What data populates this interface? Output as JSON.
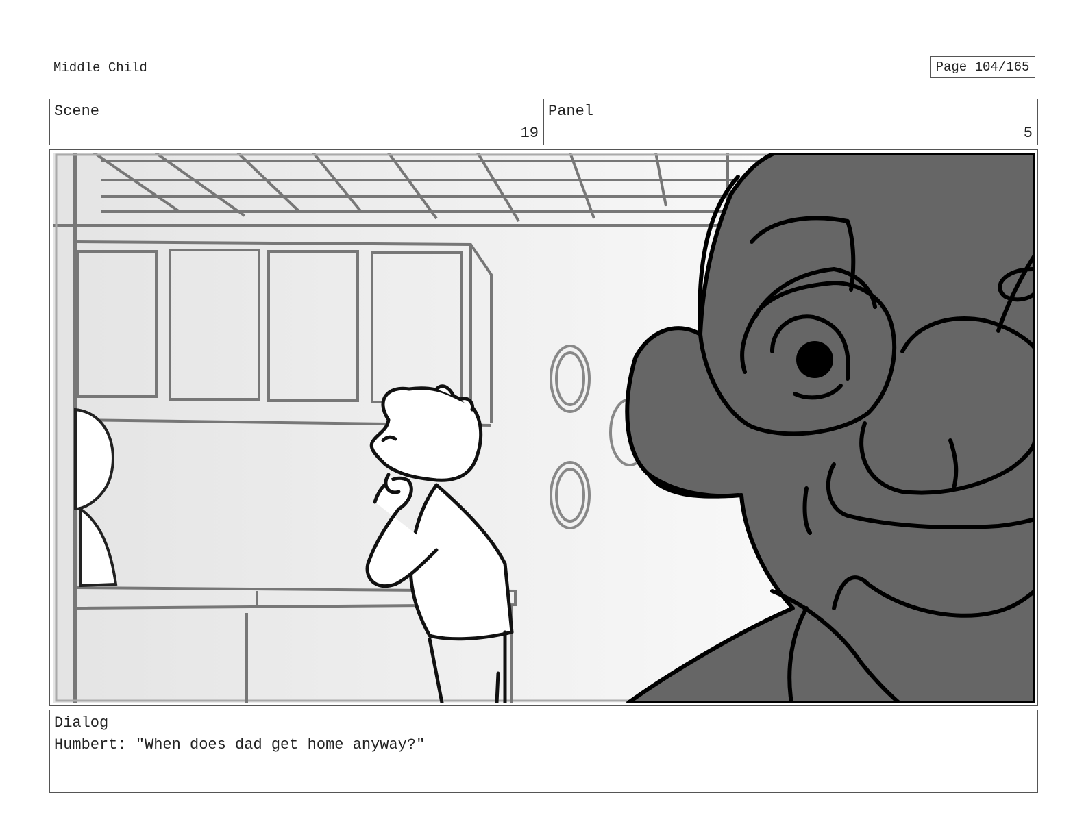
{
  "header": {
    "title": "Middle Child",
    "page": "Page 104/165"
  },
  "scene": {
    "label": "Scene",
    "value": "19"
  },
  "panel": {
    "label": "Panel",
    "value": "5"
  },
  "dialog": {
    "label": "Dialog",
    "text": "Humbert: \"When does dad get home anyway?\""
  }
}
